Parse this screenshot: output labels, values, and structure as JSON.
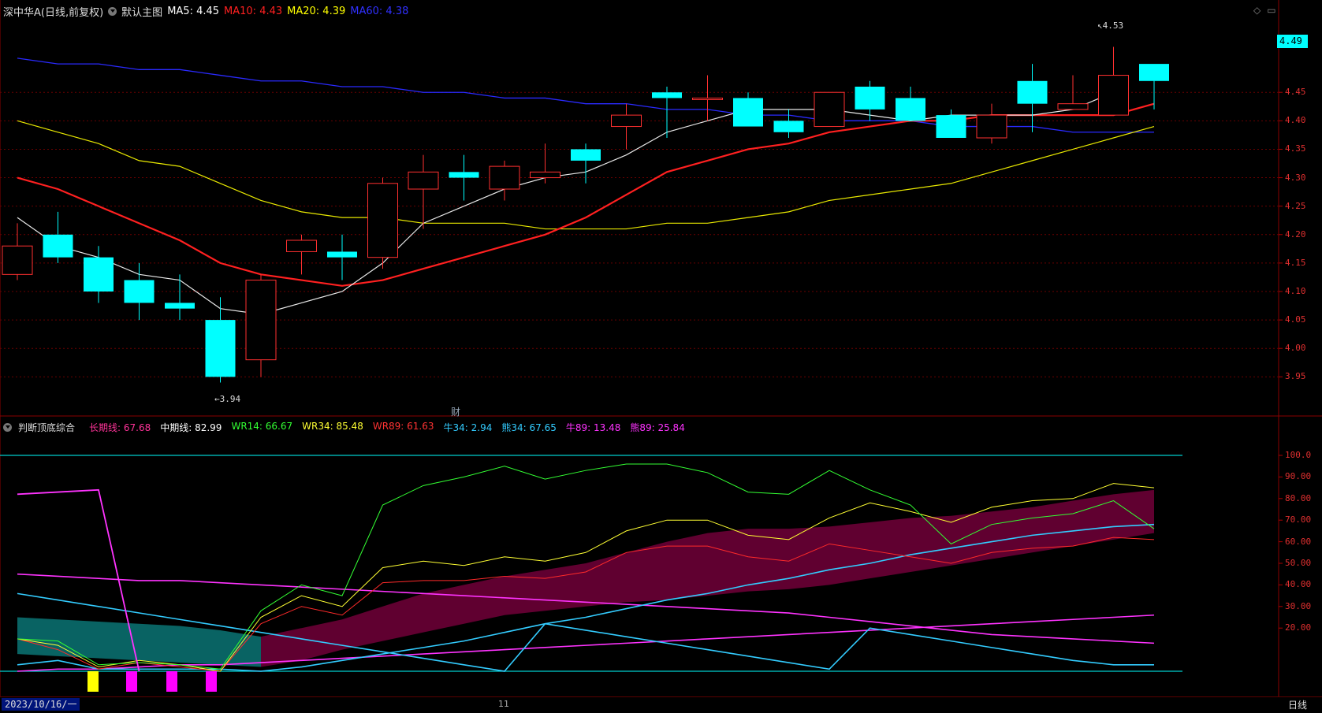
{
  "header": {
    "stock": "深中华A(日线,前复权)",
    "chart_name": "默认主图",
    "ma5": {
      "label": "MA5: 4.45",
      "color": "#ffffff"
    },
    "ma10": {
      "label": "MA10: 4.43",
      "color": "#ff2020"
    },
    "ma20": {
      "label": "MA20: 4.39",
      "color": "#ffff00"
    },
    "ma60": {
      "label": "MA60: 4.38",
      "color": "#3030ff"
    }
  },
  "indicator_header": {
    "name": "判断顶底综合",
    "items": [
      {
        "label": "长期线: 67.68",
        "color": "#ff3399"
      },
      {
        "label": "中期线: 82.99",
        "color": "#ffffff"
      },
      {
        "label": "WR14: 66.67",
        "color": "#33ff33"
      },
      {
        "label": "WR34: 85.48",
        "color": "#ffff33"
      },
      {
        "label": "WR89: 61.63",
        "color": "#ff3333"
      },
      {
        "label": "牛34: 2.94",
        "color": "#33ccff"
      },
      {
        "label": "熊34: 67.65",
        "color": "#33ccff"
      },
      {
        "label": "牛89: 13.48",
        "color": "#ff33ff"
      },
      {
        "label": "熊89: 25.84",
        "color": "#ff33ff"
      }
    ]
  },
  "current_price": "4.49",
  "annotations": {
    "high": "4.53",
    "low": "3.94",
    "cai": "财"
  },
  "bottom": {
    "date": "2023/10/16/一",
    "tick": "11",
    "period": "日线"
  },
  "chart_data": {
    "type": "candlestick",
    "price_axis": [
      "4.45",
      "4.40",
      "4.35",
      "4.30",
      "4.25",
      "4.20",
      "4.15",
      "4.10",
      "4.05",
      "4.00",
      "3.95"
    ],
    "ylim": [
      3.92,
      4.55
    ],
    "candles": [
      {
        "o": 4.13,
        "h": 4.22,
        "l": 4.12,
        "c": 4.18
      },
      {
        "o": 4.2,
        "h": 4.24,
        "l": 4.15,
        "c": 4.16
      },
      {
        "o": 4.16,
        "h": 4.18,
        "l": 4.08,
        "c": 4.1
      },
      {
        "o": 4.12,
        "h": 4.15,
        "l": 4.05,
        "c": 4.08
      },
      {
        "o": 4.08,
        "h": 4.13,
        "l": 4.05,
        "c": 4.07
      },
      {
        "o": 4.05,
        "h": 4.09,
        "l": 3.94,
        "c": 3.95
      },
      {
        "o": 3.98,
        "h": 4.13,
        "l": 3.95,
        "c": 4.12
      },
      {
        "o": 4.17,
        "h": 4.2,
        "l": 4.13,
        "c": 4.19
      },
      {
        "o": 4.17,
        "h": 4.2,
        "l": 4.12,
        "c": 4.16
      },
      {
        "o": 4.16,
        "h": 4.3,
        "l": 4.14,
        "c": 4.29
      },
      {
        "o": 4.28,
        "h": 4.34,
        "l": 4.21,
        "c": 4.31
      },
      {
        "o": 4.31,
        "h": 4.34,
        "l": 4.26,
        "c": 4.3
      },
      {
        "o": 4.28,
        "h": 4.33,
        "l": 4.26,
        "c": 4.32
      },
      {
        "o": 4.3,
        "h": 4.36,
        "l": 4.29,
        "c": 4.31
      },
      {
        "o": 4.35,
        "h": 4.36,
        "l": 4.29,
        "c": 4.33
      },
      {
        "o": 4.39,
        "h": 4.43,
        "l": 4.35,
        "c": 4.41
      },
      {
        "o": 4.45,
        "h": 4.46,
        "l": 4.37,
        "c": 4.44
      },
      {
        "o": 4.44,
        "h": 4.48,
        "l": 4.4,
        "c": 4.44
      },
      {
        "o": 4.44,
        "h": 4.45,
        "l": 4.39,
        "c": 4.39
      },
      {
        "o": 4.4,
        "h": 4.42,
        "l": 4.37,
        "c": 4.38
      },
      {
        "o": 4.39,
        "h": 4.45,
        "l": 4.39,
        "c": 4.45
      },
      {
        "o": 4.46,
        "h": 4.47,
        "l": 4.4,
        "c": 4.42
      },
      {
        "o": 4.44,
        "h": 4.46,
        "l": 4.4,
        "c": 4.4
      },
      {
        "o": 4.41,
        "h": 4.42,
        "l": 4.37,
        "c": 4.37
      },
      {
        "o": 4.37,
        "h": 4.43,
        "l": 4.36,
        "c": 4.41
      },
      {
        "o": 4.47,
        "h": 4.5,
        "l": 4.38,
        "c": 4.43
      },
      {
        "o": 4.42,
        "h": 4.48,
        "l": 4.42,
        "c": 4.43
      },
      {
        "o": 4.41,
        "h": 4.53,
        "l": 4.41,
        "c": 4.48
      },
      {
        "o": 4.5,
        "h": 4.5,
        "l": 4.42,
        "c": 4.47
      }
    ],
    "ma5": [
      4.23,
      4.18,
      4.16,
      4.13,
      4.12,
      4.07,
      4.06,
      4.08,
      4.1,
      4.15,
      4.22,
      4.25,
      4.28,
      4.3,
      4.31,
      4.34,
      4.38,
      4.4,
      4.42,
      4.42,
      4.42,
      4.41,
      4.4,
      4.41,
      4.41,
      4.41,
      4.42,
      4.45
    ],
    "ma10": [
      4.3,
      4.28,
      4.25,
      4.22,
      4.19,
      4.15,
      4.13,
      4.12,
      4.11,
      4.12,
      4.14,
      4.16,
      4.18,
      4.2,
      4.23,
      4.27,
      4.31,
      4.33,
      4.35,
      4.36,
      4.38,
      4.39,
      4.4,
      4.4,
      4.41,
      4.41,
      4.41,
      4.41,
      4.43
    ],
    "ma20": [
      4.4,
      4.38,
      4.36,
      4.33,
      4.32,
      4.29,
      4.26,
      4.24,
      4.23,
      4.23,
      4.22,
      4.22,
      4.22,
      4.21,
      4.21,
      4.21,
      4.22,
      4.22,
      4.23,
      4.24,
      4.26,
      4.27,
      4.28,
      4.29,
      4.31,
      4.33,
      4.35,
      4.37,
      4.39
    ],
    "ma60": [
      4.51,
      4.5,
      4.5,
      4.49,
      4.49,
      4.48,
      4.47,
      4.47,
      4.46,
      4.46,
      4.45,
      4.45,
      4.44,
      4.44,
      4.43,
      4.43,
      4.42,
      4.42,
      4.41,
      4.41,
      4.4,
      4.4,
      4.4,
      4.39,
      4.39,
      4.39,
      4.38,
      4.38,
      4.38
    ],
    "indicator_axis": [
      "100.0",
      "90.00",
      "80.00",
      "70.00",
      "60.00",
      "50.00",
      "40.00",
      "30.00",
      "20.00"
    ],
    "wr14": [
      15,
      14,
      3,
      4,
      3,
      1,
      28,
      40,
      35,
      77,
      86,
      90,
      95,
      89,
      93,
      96,
      96,
      92,
      83,
      82,
      93,
      84,
      77,
      59,
      68,
      71,
      73,
      79,
      66
    ],
    "wr34": [
      15,
      12,
      2,
      5,
      3,
      0,
      25,
      35,
      30,
      48,
      51,
      49,
      53,
      51,
      55,
      65,
      70,
      70,
      63,
      61,
      71,
      78,
      74,
      69,
      76,
      79,
      80,
      87,
      85
    ],
    "wr89": [
      15,
      10,
      1,
      4,
      2,
      0,
      22,
      30,
      26,
      41,
      42,
      42,
      44,
      43,
      46,
      55,
      58,
      58,
      53,
      51,
      59,
      56,
      53,
      50,
      55,
      57,
      58,
      62,
      61
    ],
    "bull_bear_cyan": [
      36,
      33,
      30,
      27,
      24,
      21,
      18,
      15,
      12,
      9,
      6,
      3,
      0,
      22,
      19,
      16,
      13,
      10,
      7,
      4,
      1,
      20,
      17,
      14,
      11,
      8,
      5,
      3,
      3
    ],
    "bull_cyan_up": [
      3,
      5,
      1,
      1,
      1,
      1,
      0,
      2,
      5,
      8,
      11,
      14,
      18,
      22,
      25,
      29,
      33,
      36,
      40,
      43,
      47,
      50,
      54,
      57,
      60,
      63,
      65,
      67,
      68
    ],
    "bull89_pink": [
      45,
      44,
      43,
      42,
      42,
      41,
      40,
      39,
      38,
      37,
      36,
      35,
      34,
      33,
      32,
      31,
      30,
      29,
      28,
      27,
      25,
      23,
      21,
      19,
      17,
      16,
      15,
      14,
      13
    ],
    "bear89_pink": [
      0,
      1,
      1,
      2,
      3,
      3,
      4,
      5,
      6,
      7,
      8,
      9,
      10,
      11,
      12,
      13,
      14,
      15,
      16,
      17,
      18,
      19,
      20,
      21,
      22,
      23,
      24,
      25,
      26
    ],
    "long_line": [
      82,
      83,
      84,
      82,
      0,
      0,
      0,
      0,
      0,
      0,
      0,
      0,
      0,
      0,
      0,
      0,
      0,
      0,
      0,
      0,
      0,
      0,
      0,
      0,
      0,
      0,
      0,
      0,
      0
    ],
    "band_top": [
      25,
      24,
      23,
      22,
      21,
      19,
      16,
      20,
      24,
      30,
      36,
      40,
      44,
      47,
      50,
      55,
      60,
      64,
      66,
      66,
      67,
      69,
      71,
      72,
      74,
      76,
      79,
      82,
      84
    ],
    "band_bottom": [
      8,
      7,
      6,
      5,
      4,
      3,
      2,
      5,
      10,
      14,
      18,
      22,
      26,
      28,
      30,
      32,
      33,
      35,
      37,
      38,
      40,
      43,
      46,
      49,
      52,
      55,
      58,
      61,
      64
    ],
    "signals": [
      {
        "x": 118,
        "color": "#ffff00"
      },
      {
        "x": 167,
        "color": "#ff00ff"
      },
      {
        "x": 218,
        "color": "#ff00ff"
      },
      {
        "x": 268,
        "color": "#ff00ff"
      }
    ]
  }
}
